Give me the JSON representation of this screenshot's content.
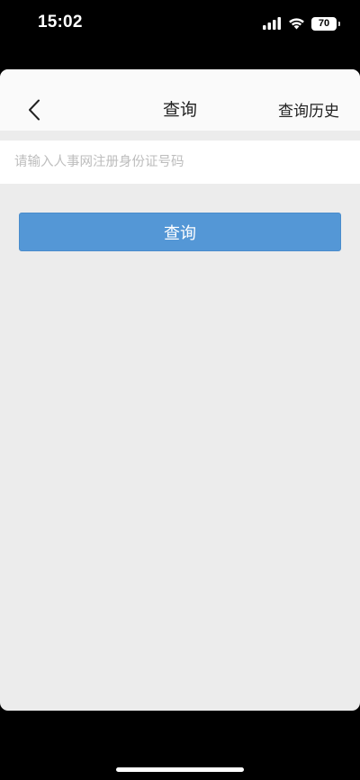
{
  "status_bar": {
    "time": "15:02",
    "battery_level": "70",
    "icons": [
      "signal-icon",
      "wifi-icon",
      "battery-icon"
    ]
  },
  "nav": {
    "back_icon": "chevron-left-icon",
    "title": "查询",
    "history_label": "查询历史"
  },
  "form": {
    "id_input_value": "",
    "id_input_placeholder": "请输入人事网注册身份证号码",
    "query_button_label": "查询"
  },
  "colors": {
    "primary_button": "#5497d6",
    "page_background": "#ececec",
    "nav_background": "#fafafa"
  }
}
